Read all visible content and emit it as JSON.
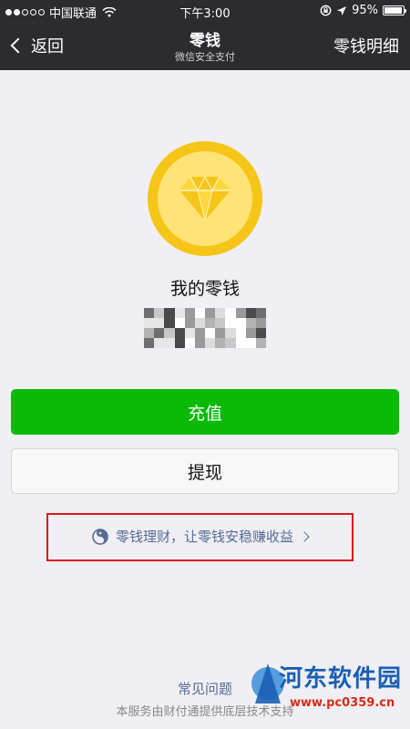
{
  "status_bar": {
    "carrier": "中国联通",
    "time": "下午3:00",
    "battery": "95%",
    "battery_level": 0.95
  },
  "nav": {
    "back_label": "返回",
    "title": "零钱",
    "subtitle": "微信安全支付",
    "right_link": "零钱明细"
  },
  "wallet": {
    "label": "我的零钱"
  },
  "actions": {
    "recharge_label": "充值",
    "withdraw_label": "提现"
  },
  "promo": {
    "text": "零钱理财，让零钱安稳赚收益"
  },
  "footer": {
    "faq_label": "常见问题",
    "service_text": "本服务由财付通提供底层技术支持"
  },
  "watermark": {
    "title": "河东软件园",
    "url": "www.pc0359.cn"
  },
  "colors": {
    "topbar": "#2b2b30",
    "recharge": "#09bb07",
    "link": "#576b95",
    "highlight_border": "#e0141a",
    "coin_outer": "#f5c518",
    "coin_inner": "#ffe377"
  }
}
